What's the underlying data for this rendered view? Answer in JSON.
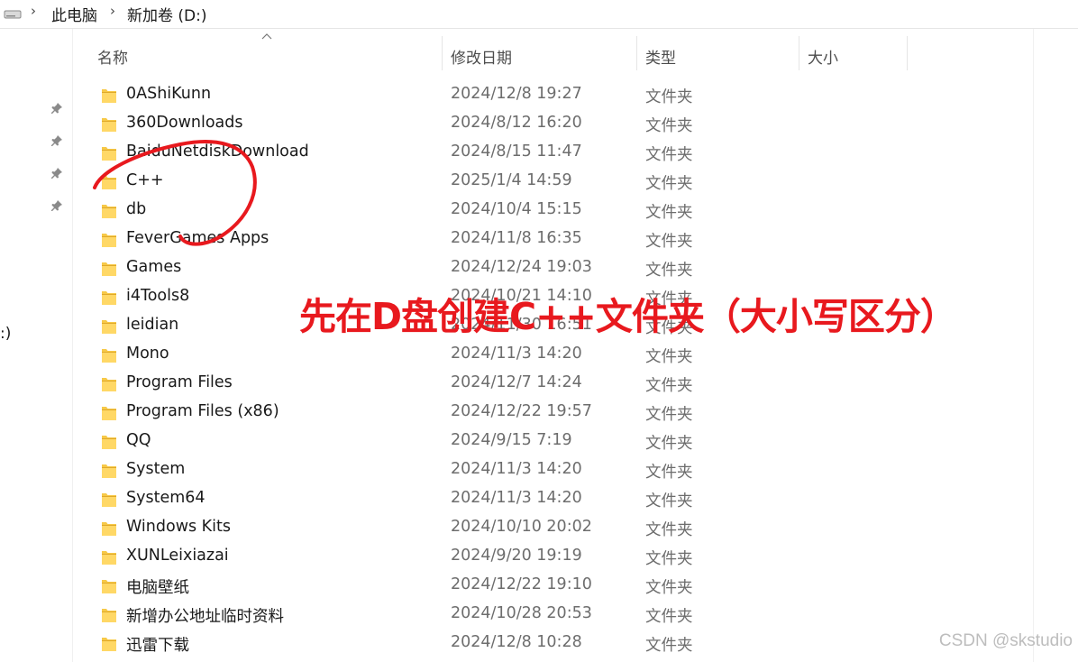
{
  "breadcrumb": {
    "items": [
      "此电脑",
      "新加卷 (D:)"
    ]
  },
  "nav": {
    "clipped_label": ":)"
  },
  "columns": {
    "name": "名称",
    "modified": "修改日期",
    "type": "类型",
    "size": "大小"
  },
  "files": [
    {
      "name": "0AShiKunn",
      "modified": "2024/12/8 19:27",
      "type": "文件夹"
    },
    {
      "name": "360Downloads",
      "modified": "2024/8/12 16:20",
      "type": "文件夹"
    },
    {
      "name": "BaiduNetdiskDownload",
      "modified": "2024/8/15 11:47",
      "type": "文件夹"
    },
    {
      "name": "C++",
      "modified": "2025/1/4 14:59",
      "type": "文件夹"
    },
    {
      "name": "db",
      "modified": "2024/10/4 15:15",
      "type": "文件夹"
    },
    {
      "name": "FeverGames Apps",
      "modified": "2024/11/8 16:35",
      "type": "文件夹"
    },
    {
      "name": "Games",
      "modified": "2024/12/24 19:03",
      "type": "文件夹"
    },
    {
      "name": "i4Tools8",
      "modified": "2024/10/21 14:10",
      "type": "文件夹"
    },
    {
      "name": "leidian",
      "modified": "2024/11/30 16:51",
      "type": "文件夹"
    },
    {
      "name": "Mono",
      "modified": "2024/11/3 14:20",
      "type": "文件夹"
    },
    {
      "name": "Program Files",
      "modified": "2024/12/7 14:24",
      "type": "文件夹"
    },
    {
      "name": "Program Files (x86)",
      "modified": "2024/12/22 19:57",
      "type": "文件夹"
    },
    {
      "name": "QQ",
      "modified": "2024/9/15 7:19",
      "type": "文件夹"
    },
    {
      "name": "System",
      "modified": "2024/11/3 14:20",
      "type": "文件夹"
    },
    {
      "name": "System64",
      "modified": "2024/11/3 14:20",
      "type": "文件夹"
    },
    {
      "name": "Windows Kits",
      "modified": "2024/10/10 20:02",
      "type": "文件夹"
    },
    {
      "name": "XUNLeixiazai",
      "modified": "2024/9/20 19:19",
      "type": "文件夹"
    },
    {
      "name": "电脑壁纸",
      "modified": "2024/12/22 19:10",
      "type": "文件夹"
    },
    {
      "name": "新增办公地址临时资料",
      "modified": "2024/10/28 20:53",
      "type": "文件夹"
    },
    {
      "name": "迅雷下载",
      "modified": "2024/12/8 10:28",
      "type": "文件夹"
    }
  ],
  "annotation": {
    "text": "先在D盘创建C++文件夹（大小写区分）",
    "color": "#e8191e"
  },
  "watermark": "CSDN @skstudio",
  "colors": {
    "folder_yellow": "#f7c948",
    "annotation_red": "#e8191e"
  },
  "icons": {
    "drive": "drive-icon",
    "pin": "pin-icon",
    "folder": "folder-icon",
    "sort": "sort-up-icon"
  }
}
